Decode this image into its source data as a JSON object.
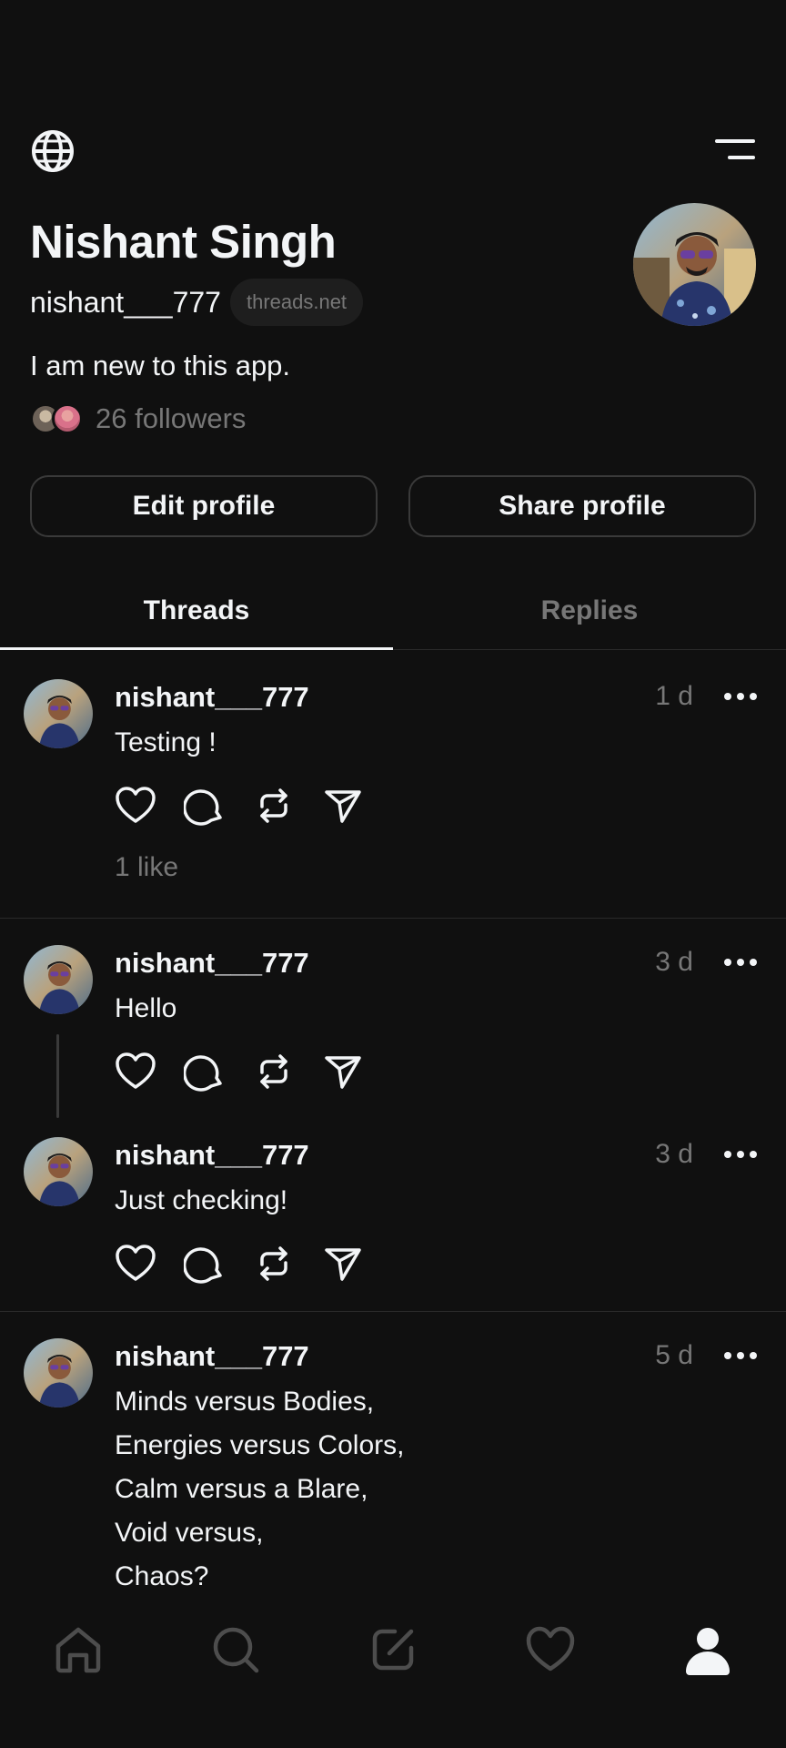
{
  "profile": {
    "name": "Nishant Singh",
    "handle": "nishant___777",
    "domain_chip": "threads.net",
    "bio": "I am new to this app.",
    "followers": "26 followers",
    "edit_label": "Edit profile",
    "share_label": "Share profile"
  },
  "tabs": [
    {
      "label": "Threads",
      "active": true
    },
    {
      "label": "Replies",
      "active": false
    }
  ],
  "posts": [
    {
      "user": "nishant___777",
      "time": "1 d",
      "text": "Testing !",
      "likes": "1 like"
    },
    {
      "user": "nishant___777",
      "time": "3 d",
      "text": "Hello"
    },
    {
      "user": "nishant___777",
      "time": "3 d",
      "text": "Just checking!"
    },
    {
      "user": "nishant___777",
      "time": "5 d",
      "lines": [
        "Minds versus Bodies,",
        "Energies versus Colors,",
        "Calm versus a Blare,",
        "Void versus,",
        "Chaos?"
      ]
    }
  ],
  "icons": {
    "top_left": "globe-icon",
    "top_right": "menu-icon",
    "actions": [
      "heart-icon",
      "comment-icon",
      "repost-icon",
      "send-icon"
    ],
    "nav": [
      "home-icon",
      "search-icon",
      "compose-icon",
      "activity-heart-icon",
      "profile-icon"
    ]
  },
  "colors": {
    "background": "#101010",
    "text_primary": "#f3f5f7",
    "text_secondary": "#777777",
    "border": "#3a3a3a"
  }
}
